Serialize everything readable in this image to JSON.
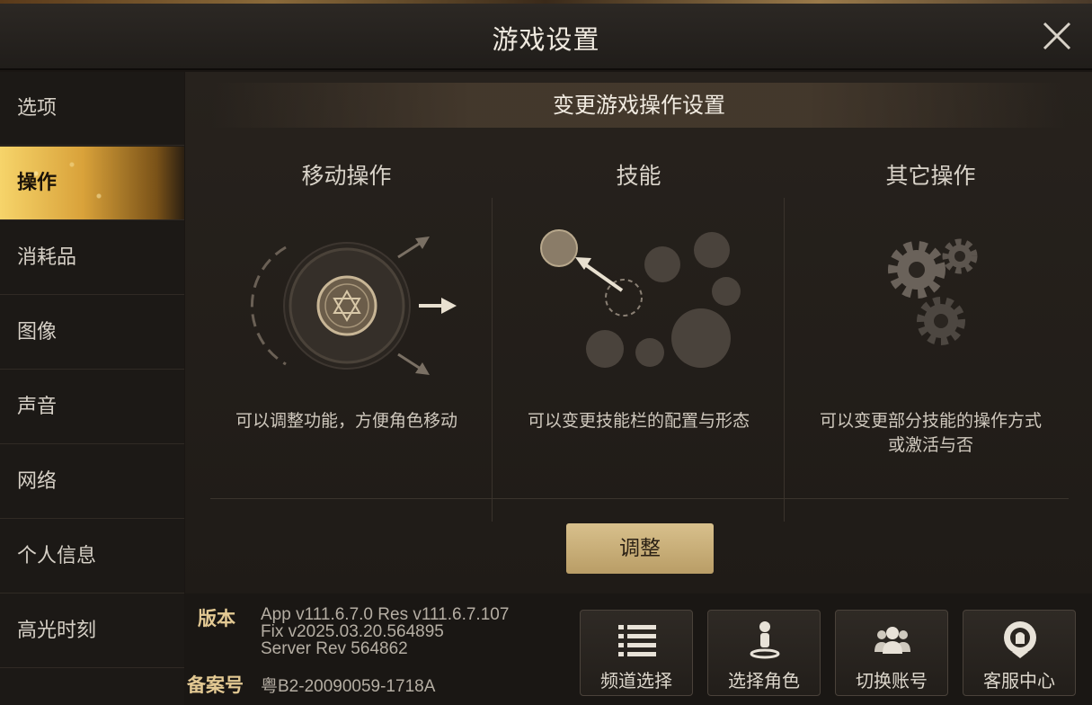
{
  "window": {
    "title": "游戏设置"
  },
  "sidebar": {
    "items": [
      {
        "label": "选项"
      },
      {
        "label": "操作",
        "active": true
      },
      {
        "label": "消耗品"
      },
      {
        "label": "图像"
      },
      {
        "label": "声音"
      },
      {
        "label": "网络"
      },
      {
        "label": "个人信息"
      },
      {
        "label": "高光时刻"
      }
    ]
  },
  "main": {
    "header": "变更游戏操作设置",
    "columns": [
      {
        "title": "移动操作",
        "desc": "可以调整功能，方便角色移动",
        "icon": "joystick-illustration"
      },
      {
        "title": "技能",
        "desc": "可以变更技能栏的配置与形态",
        "icon": "skill-layout-illustration"
      },
      {
        "title": "其它操作",
        "desc": "可以变更部分技能的操作方式或激活与否",
        "icon": "gears-illustration"
      }
    ],
    "adjust_label": "调整"
  },
  "footer": {
    "version_label": "版本",
    "version_lines": [
      "App v111.6.7.0 Res v111.6.7.107",
      "Fix v2025.03.20.564895",
      "Server Rev 564862"
    ],
    "record_label": "备案号",
    "record_value": "粤B2-20090059-1718A",
    "buttons": [
      {
        "label": "频道选择",
        "icon": "list-icon"
      },
      {
        "label": "选择角色",
        "icon": "character-pin-icon"
      },
      {
        "label": "切换账号",
        "icon": "users-icon"
      },
      {
        "label": "客服中心",
        "icon": "headset-icon"
      }
    ]
  },
  "colors": {
    "accent_gold": "#e3c993",
    "active_tab": "#f6d46a",
    "button_gold": "#c8ae78"
  }
}
